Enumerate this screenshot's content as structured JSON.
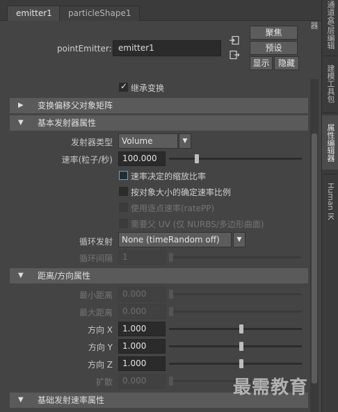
{
  "tabs": [
    "emitter1",
    "particleShape1"
  ],
  "point_emitter": {
    "label": "pointEmitter:",
    "value": "emitter1"
  },
  "buttons": {
    "focus": "聚焦",
    "preset": "预设",
    "show": "显示",
    "hide": "隐藏"
  },
  "inherit_transform": {
    "label": "继承变换",
    "checked": true
  },
  "frames": {
    "offset": "变换偏移父对象矩阵",
    "basic": "基本发射器属性",
    "distance": "距离/方向属性",
    "rate": "基础发射速率属性"
  },
  "basic": {
    "emitter_type_label": "发射器类型",
    "emitter_type_value": "Volume",
    "rate_label": "速率(粒子/秒)",
    "rate_value": "100.000",
    "rate_slider": 0.06,
    "opt1": "速率决定的缩放比率",
    "opt2": "按对象大小的确定速率比例",
    "opt3": "使用逐点速率(ratePP)",
    "opt4": "需要父 UV (仅 NURBS/多边形曲面)",
    "cycle_label": "循环发射",
    "cycle_value": "None (timeRandom off)",
    "cycle_interval_label": "循环间隔",
    "cycle_interval_value": "1"
  },
  "distance": {
    "min_label": "最小距离",
    "min_value": "0.000",
    "max_label": "最大距离",
    "max_value": "0.000",
    "dirx_label": "方向 X",
    "dirx_value": "1.000",
    "diry_label": "方向 Y",
    "diry_value": "1.000",
    "dirz_label": "方向 Z",
    "dirz_value": "1.000",
    "spread_label": "扩散",
    "spread_value": "0.000"
  },
  "dock_tabs": [
    "通道盒/层编辑器",
    "建模工具包",
    "属性编辑器",
    "Human IK"
  ],
  "watermark": "最需教育",
  "icons": {
    "expand": "triangle-right-icon",
    "collapse": "triangle-down-icon",
    "arrow": "dropdown-arrow-icon"
  }
}
